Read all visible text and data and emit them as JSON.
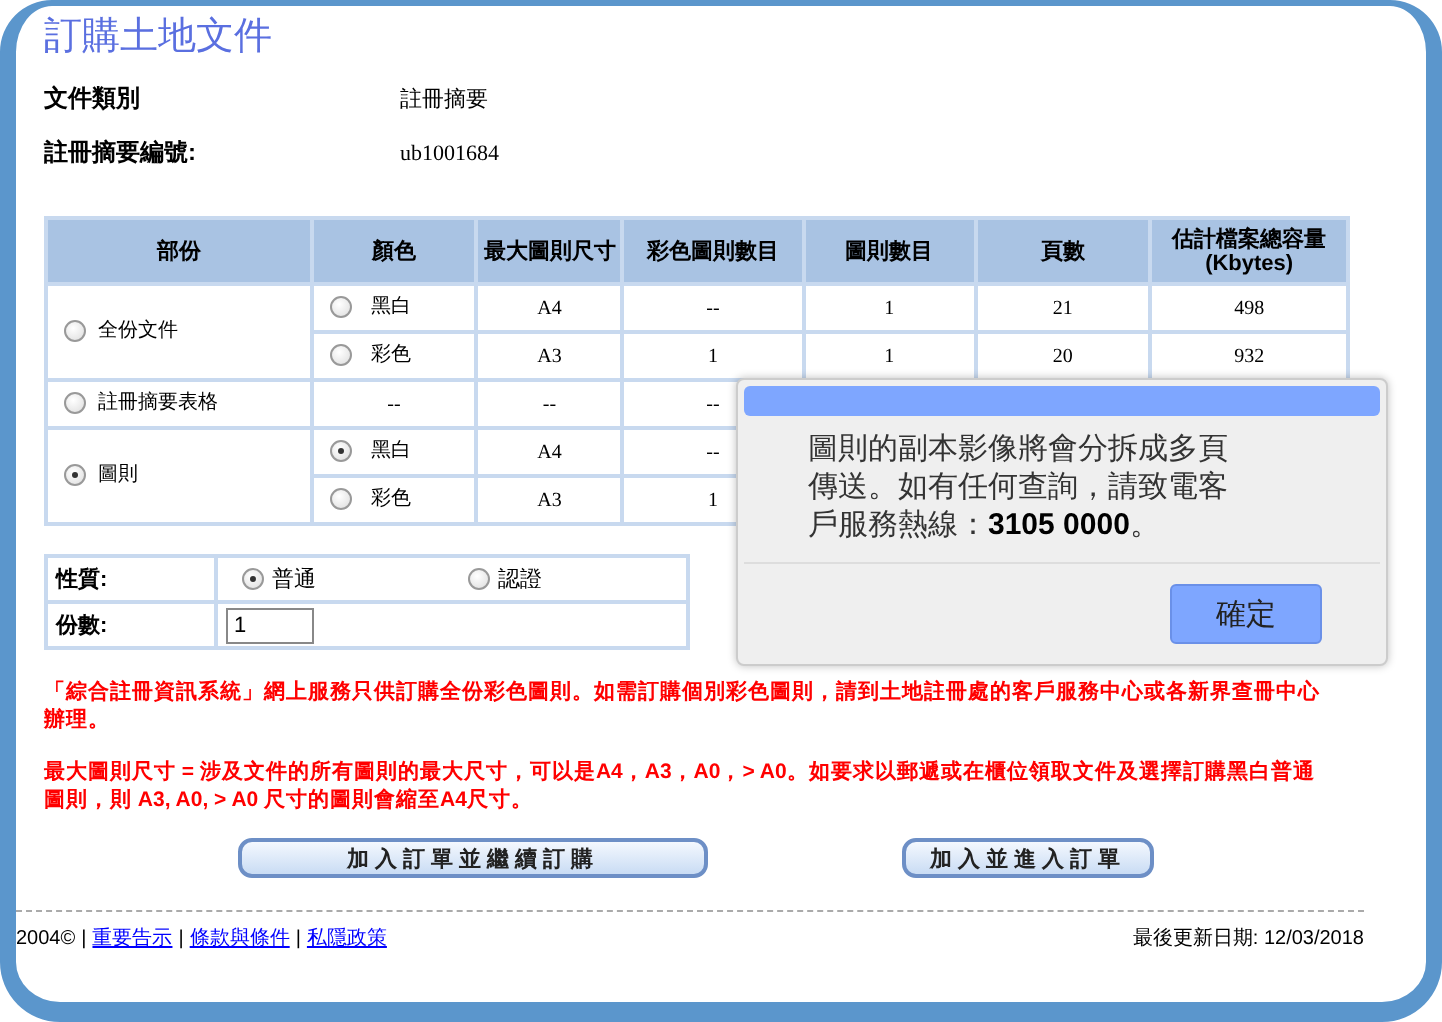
{
  "title": "訂購土地文件",
  "info": [
    {
      "label": "文件類別",
      "value": "註冊摘要"
    },
    {
      "label": "註冊摘要編號:",
      "value": "ub1001684"
    }
  ],
  "table": {
    "columns": [
      "部份",
      "顏色",
      "最大圖則尺寸",
      "彩色圖則數目",
      "圖則數目",
      "頁數",
      "估計檔案總容量 (Kbytes)"
    ],
    "groups": [
      {
        "label": "全份文件",
        "selected": false,
        "rows": [
          {
            "kind": "radio",
            "option": "黑白",
            "selected": false,
            "cells": [
              "A4",
              "--",
              "1",
              "21",
              "498"
            ]
          },
          {
            "kind": "radio",
            "option": "彩色",
            "selected": false,
            "cells": [
              "A3",
              "1",
              "1",
              "20",
              "932"
            ]
          }
        ]
      },
      {
        "label": "註冊摘要表格",
        "selected": false,
        "rows": [
          {
            "kind": "text",
            "option": "--",
            "cells": [
              "--",
              "--"
            ]
          }
        ]
      },
      {
        "label": "圖則",
        "selected": true,
        "rows": [
          {
            "kind": "radio",
            "option": "黑白",
            "selected": true,
            "cells": [
              "A4",
              "--"
            ]
          },
          {
            "kind": "radio",
            "option": "彩色",
            "selected": false,
            "cells": [
              "A3",
              "1"
            ]
          }
        ]
      }
    ]
  },
  "form": {
    "nature_label": "性質:",
    "nature_options": [
      {
        "label": "普通",
        "selected": true
      },
      {
        "label": "認證",
        "selected": false
      }
    ],
    "copies_label": "份數:",
    "copies_value": "1"
  },
  "notes": [
    "「綜合註冊資訊系統」網上服務只供訂購全份彩色圖則。如需訂購個別彩色圖則，請到土地註冊處的客戶服務中心或各新界查冊中心辦理。",
    "最大圖則尺寸 = 涉及文件的所有圖則的最大尺寸，可以是A4，A3，A0，> A0。如要求以郵遞或在櫃位領取文件及選擇訂購黑白普通圖則，則 A3, A0, > A0 尺寸的圖則會縮至A4尺寸。"
  ],
  "buttons": [
    "加入訂單並繼續訂購",
    "加入並進入訂單"
  ],
  "footer": {
    "parts": [
      {
        "kind": "text",
        "text": "2004©"
      },
      {
        "kind": "text",
        "text": "|"
      },
      {
        "kind": "link",
        "text": "重要告示"
      },
      {
        "kind": "text",
        "text": "|"
      },
      {
        "kind": "link",
        "text": "條款與條件"
      },
      {
        "kind": "text",
        "text": "|"
      },
      {
        "kind": "link",
        "text": "私隱政策"
      }
    ],
    "updated": "最後更新日期: 12/03/2018"
  },
  "dialog": {
    "message": "圖則的副本影像將會分拆成多頁傳送。如有任何查詢，請致電客戶服務熱線：**3105 0000**。",
    "button": "確定"
  }
}
